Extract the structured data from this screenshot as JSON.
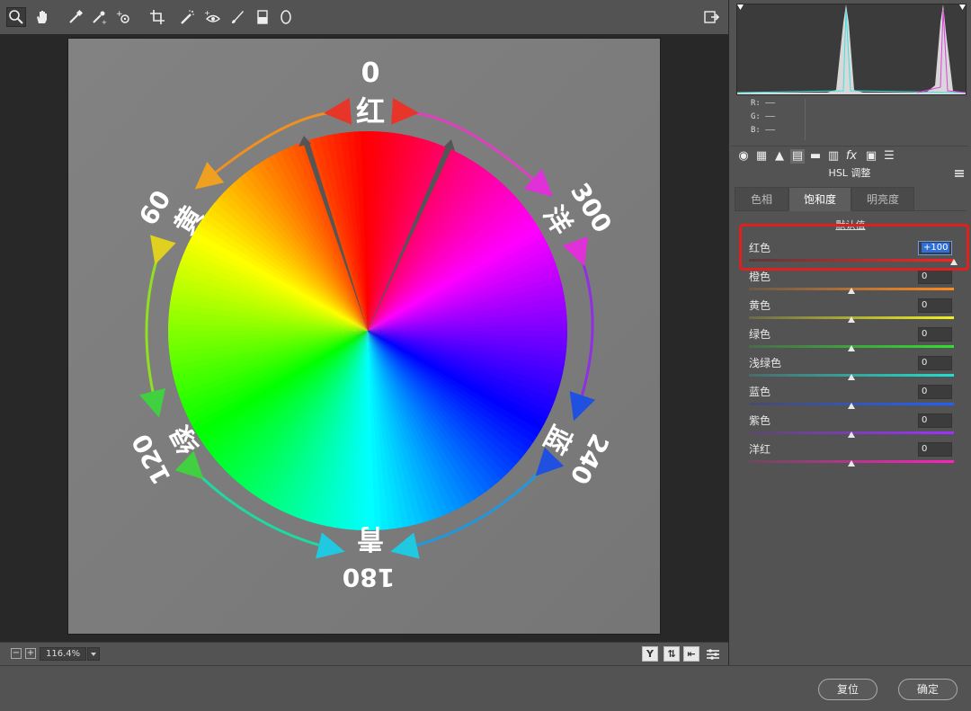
{
  "toolbar": {
    "tools": [
      "zoom-icon",
      "hand-icon",
      "white-balance-icon",
      "color-sampler-icon",
      "target-adjust-icon",
      "crop-icon",
      "spot-removal-icon",
      "red-eye-icon",
      "adjustment-brush-icon",
      "graduated-filter-icon",
      "radial-filter-icon"
    ],
    "open_preferences_icon": "preferences-icon"
  },
  "canvas": {
    "labels": {
      "top_num": "0",
      "top_char": "红",
      "tl_num": "60",
      "tl_char": "黄",
      "tr_num": "300",
      "tr_char": "洋",
      "bl_num": "120",
      "bl_char": "绿",
      "br_num": "240",
      "br_char": "蓝",
      "bottom_num": "180",
      "bottom_char": "青"
    }
  },
  "statusbar": {
    "zoom_out": "−",
    "zoom_in": "+",
    "zoom_value": "116.4%",
    "view_y": "Y"
  },
  "readout": {
    "r": "R:  ——",
    "g": "G:  ——",
    "b": "B:  ——"
  },
  "panel": {
    "title": "HSL 调整",
    "tabs": [
      "色相",
      "饱和度",
      "明亮度"
    ],
    "active_tab": "饱和度",
    "default_link": "默认值",
    "sliders": [
      {
        "label": "红色",
        "value": "+100",
        "level_percent": 100,
        "colors": [
          "#5a3a3a",
          "#ff2020"
        ]
      },
      {
        "label": "橙色",
        "value": "0",
        "level_percent": 50,
        "colors": [
          "#6a5a4a",
          "#ff8a20"
        ]
      },
      {
        "label": "黄色",
        "value": "0",
        "level_percent": 50,
        "colors": [
          "#6a6a4a",
          "#f0f020"
        ]
      },
      {
        "label": "绿色",
        "value": "0",
        "level_percent": 50,
        "colors": [
          "#4a6a4a",
          "#30e030"
        ]
      },
      {
        "label": "浅绿色",
        "value": "0",
        "level_percent": 50,
        "colors": [
          "#4a6a6a",
          "#20e0d0"
        ]
      },
      {
        "label": "蓝色",
        "value": "0",
        "level_percent": 50,
        "colors": [
          "#4a4a6a",
          "#2060ff"
        ]
      },
      {
        "label": "紫色",
        "value": "0",
        "level_percent": 50,
        "colors": [
          "#5a4a6a",
          "#a030ff"
        ]
      },
      {
        "label": "洋红",
        "value": "0",
        "level_percent": 50,
        "colors": [
          "#6a4a5a",
          "#ff20c0"
        ]
      }
    ]
  },
  "footer": {
    "reset": "复位",
    "ok": "确定"
  }
}
